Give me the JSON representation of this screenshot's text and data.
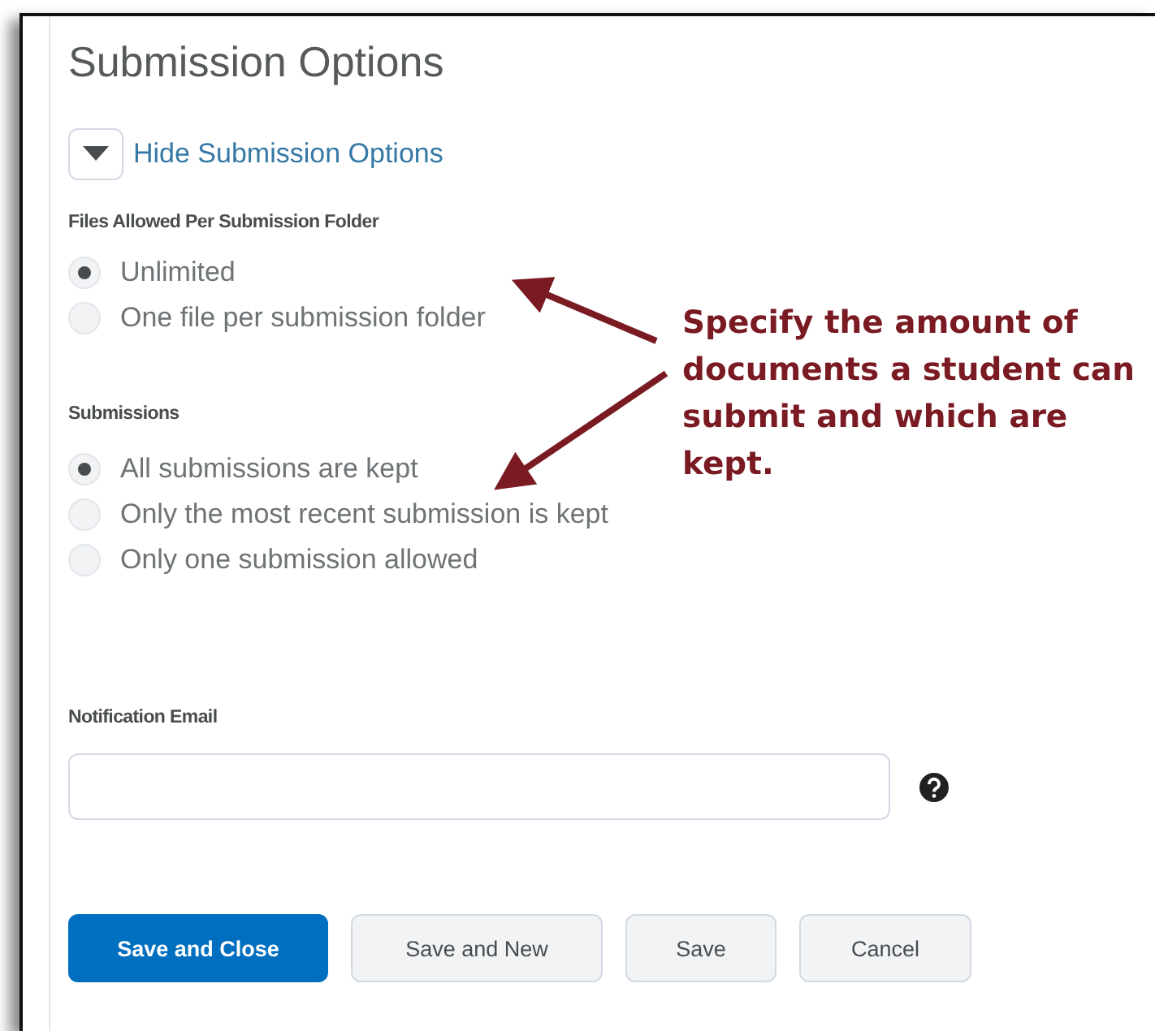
{
  "page": {
    "title": "Submission Options"
  },
  "toggle": {
    "label": "Hide Submission Options",
    "expanded": true
  },
  "groups": [
    {
      "label": "Files Allowed Per Submission Folder",
      "options": [
        {
          "label": "Unlimited",
          "selected": true
        },
        {
          "label": "One file per submission folder",
          "selected": false
        }
      ]
    },
    {
      "label": "Submissions",
      "options": [
        {
          "label": "All submissions are kept",
          "selected": true
        },
        {
          "label": "Only the most recent submission is kept",
          "selected": false
        },
        {
          "label": "Only one submission allowed",
          "selected": false
        }
      ]
    }
  ],
  "email": {
    "label": "Notification Email"
  },
  "buttons": [
    {
      "label": "Save and Close",
      "kind": "primary"
    },
    {
      "label": "Save and New",
      "kind": "secondary"
    },
    {
      "label": "Save",
      "kind": "secondary"
    },
    {
      "label": "Cancel",
      "kind": "secondary"
    }
  ],
  "callout": {
    "text": "Specify the amount of documents a student can submit and which are kept."
  }
}
